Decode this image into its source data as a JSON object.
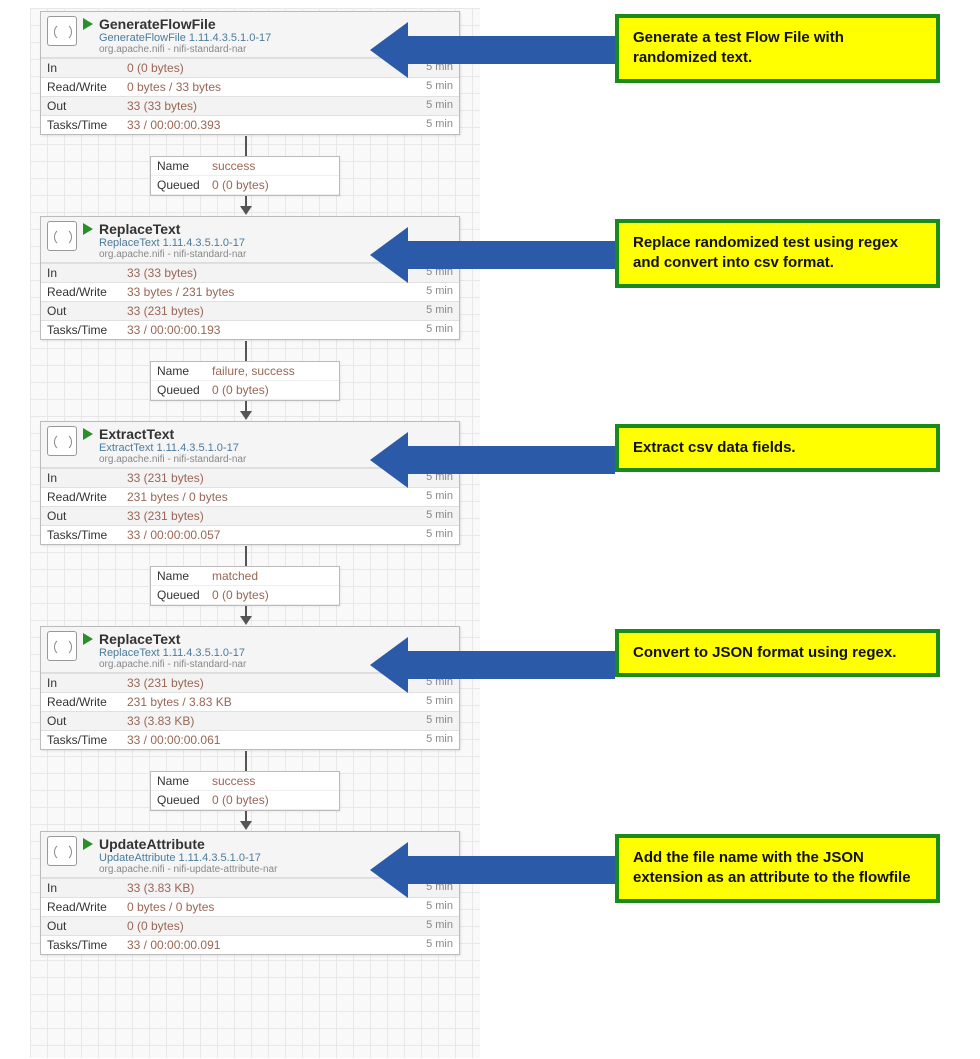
{
  "labels": {
    "in": "In",
    "rw": "Read/Write",
    "out": "Out",
    "tt": "Tasks/Time",
    "name": "Name",
    "queued": "Queued",
    "time": "5 min"
  },
  "processors": [
    {
      "name": "GenerateFlowFile",
      "type": "GenerateFlowFile 1.11.4.3.5.1.0-17",
      "bundle": "org.apache.nifi - nifi-standard-nar",
      "in": "0 (0 bytes)",
      "rw": "0 bytes / 33 bytes",
      "out": "33 (33 bytes)",
      "tt": "33 / 00:00:00.393"
    },
    {
      "name": "ReplaceText",
      "type": "ReplaceText 1.11.4.3.5.1.0-17",
      "bundle": "org.apache.nifi - nifi-standard-nar",
      "in": "33 (33 bytes)",
      "rw": "33 bytes / 231 bytes",
      "out": "33 (231 bytes)",
      "tt": "33 / 00:00:00.193"
    },
    {
      "name": "ExtractText",
      "type": "ExtractText 1.11.4.3.5.1.0-17",
      "bundle": "org.apache.nifi - nifi-standard-nar",
      "in": "33 (231 bytes)",
      "rw": "231 bytes / 0 bytes",
      "out": "33 (231 bytes)",
      "tt": "33 / 00:00:00.057"
    },
    {
      "name": "ReplaceText",
      "type": "ReplaceText 1.11.4.3.5.1.0-17",
      "bundle": "org.apache.nifi - nifi-standard-nar",
      "in": "33 (231 bytes)",
      "rw": "231 bytes / 3.83 KB",
      "out": "33 (3.83 KB)",
      "tt": "33 / 00:00:00.061"
    },
    {
      "name": "UpdateAttribute",
      "type": "UpdateAttribute 1.11.4.3.5.1.0-17",
      "bundle": "org.apache.nifi - nifi-update-attribute-nar",
      "in": "33 (3.83 KB)",
      "rw": "0 bytes / 0 bytes",
      "out": "0 (0 bytes)",
      "tt": "33 / 00:00:00.091"
    }
  ],
  "connections": [
    {
      "name": "success",
      "queued": "0 (0 bytes)"
    },
    {
      "name": "failure, success",
      "queued": "0 (0 bytes)"
    },
    {
      "name": "matched",
      "queued": "0 (0 bytes)"
    },
    {
      "name": "success",
      "queued": "0 (0 bytes)"
    }
  ],
  "callouts": [
    "Generate a test Flow File with randomized text.",
    "Replace randomized test using regex and convert into csv format.",
    "Extract csv data fields.",
    "Convert to JSON format using regex.",
    "Add the file name with the JSON extension as an attribute to the flowfile"
  ]
}
